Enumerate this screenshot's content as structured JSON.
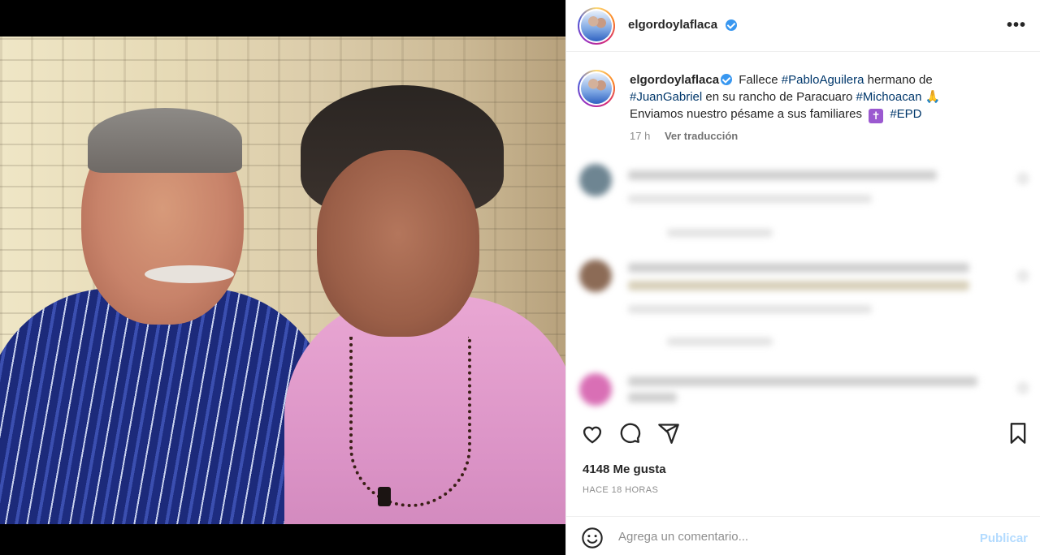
{
  "post": {
    "username": "elgordoylaflaca",
    "caption": {
      "t1": "Fallece ",
      "tag1": "#PabloAguilera",
      "t2": " hermano de ",
      "tag2": "#JuanGabriel",
      "t3": " en su rancho de Paracuaro ",
      "tag3": "#Michoacan",
      "emoji_pray": "🙏",
      "t4": "Enviamos nuestro pésame a sus familiares ",
      "emoji_cross": "✝",
      "tag4": "#EPD"
    },
    "age": "17 h",
    "translate_label": "Ver traducción",
    "likes": "4148 Me gusta",
    "timestamp": "HACE 18 HORAS",
    "more_label": "•••"
  },
  "comment_box": {
    "placeholder": "Agrega un comentario...",
    "publish_label": "Publicar"
  },
  "icons": {
    "like": "heart-icon",
    "comment": "comment-icon",
    "share": "share-icon",
    "save": "bookmark-icon",
    "emoji": "emoji-icon",
    "verified": "verified-badge-icon"
  },
  "colors": {
    "hashtag": "#00376b",
    "verified": "#3897f0",
    "publish_disabled": "#b3dbff"
  }
}
